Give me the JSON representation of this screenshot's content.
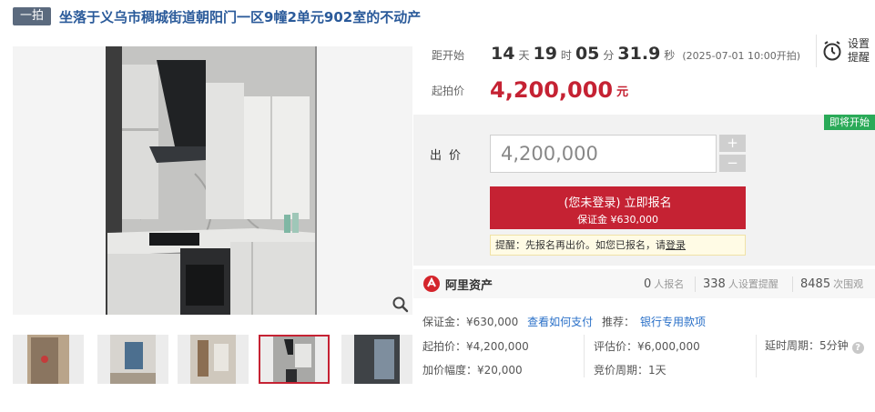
{
  "header": {
    "round_badge": "一拍",
    "title": "坐落于义乌市稠城街道朝阳门一区9幢2单元902室的不动产"
  },
  "countdown": {
    "label": "距开始",
    "days": "14",
    "days_unit": "天",
    "hours": "19",
    "hours_unit": "时",
    "minutes": "05",
    "minutes_unit": "分",
    "seconds": "31.9",
    "seconds_unit": "秒",
    "start_time": "(2025-07-01 10:00开拍)"
  },
  "reminder": {
    "line1": "设置",
    "line2": "提醒",
    "icon": "alarm-clock-icon"
  },
  "start_price": {
    "label": "起拍价",
    "value": "4,200,000",
    "unit": "元"
  },
  "status_badge": "即将开始",
  "bid": {
    "label": "出价",
    "value": "4,200,000",
    "plus": "+",
    "minus": "−"
  },
  "signup": {
    "main": "(您未登录) 立即报名",
    "deposit": "保证金 ¥630,000"
  },
  "notice": {
    "text": "提醒：先报名再出价。如您已报名，请",
    "link": "登录"
  },
  "stats": {
    "logo_text": "阿里资产",
    "signups": "0",
    "signups_label": "人报名",
    "reminders": "338",
    "reminders_label": "人设置提醒",
    "views": "8485",
    "views_label": "次围观"
  },
  "details": {
    "deposit": "保证金：¥630,000",
    "how_to_pay": "查看如何支付",
    "recommend_label": "推荐：",
    "recommend_link": "银行专用款项",
    "start_price": "起拍价：¥4,200,000",
    "appraisal": "评估价：¥6,000,000",
    "extension": "延时周期：5分钟",
    "increment": "加价幅度：¥20,000",
    "cycle": "竞价周期：1天"
  },
  "colors": {
    "accent_red": "#c52233",
    "title_blue": "#2a5a9a",
    "link_blue": "#2a70c8",
    "status_green": "#2aaa58"
  }
}
